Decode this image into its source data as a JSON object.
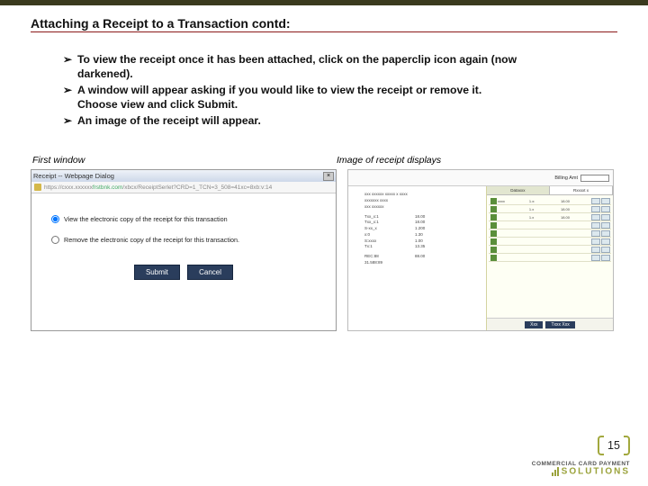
{
  "title": "Attaching a Receipt to a Transaction contd:",
  "bullets": [
    "To view the receipt once it has been attached, click on the paperclip icon again (now darkened).",
    "A window will appear asking if you would like to view the receipt or remove it.  Choose view and click Submit.",
    "An image of the receipt will appear."
  ],
  "captions": {
    "left": "First window",
    "right": "Image of receipt displays"
  },
  "dialog": {
    "title": "Receipt -- Webpage Dialog",
    "url_host": "frstbnk.com",
    "url_prefix": "https://cxxx.xxxxxx",
    "url_suffix": "/xbcx/ReceiptSerlet?CRD=1_TCN=3_508=41xc=8xb:v:14",
    "opt_view": "View the electronic copy of the receipt for this transaction",
    "opt_remove": "Remove the electronic copy of the receipt for this transaction.",
    "submit": "Submit",
    "cancel": "Cancel"
  },
  "receipt": {
    "billing_label": "Billing Amt",
    "header_lines": [
      "xxx xxxxxx xxxxx x xxxx",
      "xxxxxxx xxxx",
      "xxx xxxxxx"
    ],
    "items": [
      {
        "l": "Txx_x:1",
        "r": "18.00"
      },
      {
        "l": "Txx_x:1",
        "r": "18.00"
      },
      {
        "l": "S-xx_x",
        "r": "1.200"
      },
      {
        "l": "x:0",
        "r": "1.30"
      },
      {
        "l": "S:xxxx",
        "r": "1.00"
      },
      {
        "l": "Tx:1",
        "r": "13.35"
      }
    ],
    "totals": [
      {
        "l": "REC:88",
        "r": "88.00"
      },
      {
        "l": "31.588:89",
        "r": ""
      }
    ],
    "tabs": [
      "Dataxxx",
      "Rxxxxt x"
    ],
    "grid_rows": [
      {
        "a": "xxxx",
        "b": "1.x:",
        "c": "18.00"
      },
      {
        "a": "",
        "b": "1.x",
        "c": "18.00"
      },
      {
        "a": "",
        "b": "1.x",
        "c": "18.00"
      },
      {
        "a": "",
        "b": "",
        "c": ""
      },
      {
        "a": "",
        "b": "",
        "c": ""
      },
      {
        "a": "",
        "b": "",
        "c": ""
      },
      {
        "a": "",
        "b": "",
        "c": ""
      },
      {
        "a": "",
        "b": "",
        "c": ""
      }
    ],
    "btn1": "Xxx",
    "btn2": "Txxx Xxx"
  },
  "page_number": "15",
  "brand": {
    "line1": "COMMERCIAL CARD PAYMENT",
    "line2": "SOLUTIONS"
  }
}
